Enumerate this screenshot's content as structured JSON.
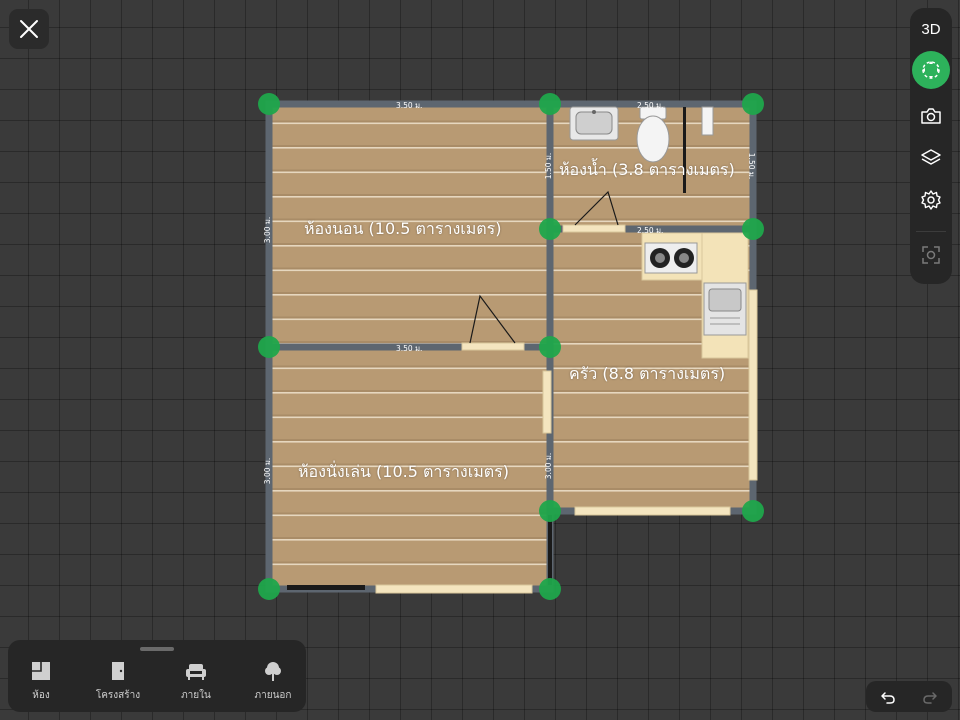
{
  "toolbar_right": {
    "view3d_label": "3D",
    "active_color": "#2db25b",
    "icons": [
      "move-icon",
      "camera-icon",
      "layers-icon",
      "gear-icon",
      "screenshot-icon"
    ]
  },
  "close_icon": "close-icon",
  "floorplan": {
    "rooms": [
      {
        "name": "ห้องนอน (10.5 ตารางเมตร)"
      },
      {
        "name": "ห้องน้ำ (3.8 ตารางเมตร)"
      },
      {
        "name": "ครัว (8.8 ตารางเมตร)"
      },
      {
        "name": "ห้องนั่งเล่น (10.5 ตารางเมตร)"
      }
    ],
    "dimensions": {
      "top_left": "3.50 ม.",
      "top_right": "2.50 ม.",
      "bath_left": "1.50 ม.",
      "bath_right": "1.50 ม.",
      "left_upper": "3.00 ม.",
      "middle_h": "3.50 ม.",
      "kitchen_top": "2.50 ม.",
      "left_lower": "3.00 ม.",
      "kitchen_left": "3.00 ม."
    },
    "wall_color": "#5d6670",
    "floor_color": "#b89a73",
    "node_color": "#1fa64b"
  },
  "bottom_tabs": [
    {
      "label": "ห้อง",
      "icon": "room-icon"
    },
    {
      "label": "โครงสร้าง",
      "icon": "door-icon"
    },
    {
      "label": "ภายใน",
      "icon": "sofa-icon"
    },
    {
      "label": "ภายนอก",
      "icon": "tree-icon"
    }
  ],
  "undo_icon": "undo-icon",
  "redo_icon": "redo-icon"
}
